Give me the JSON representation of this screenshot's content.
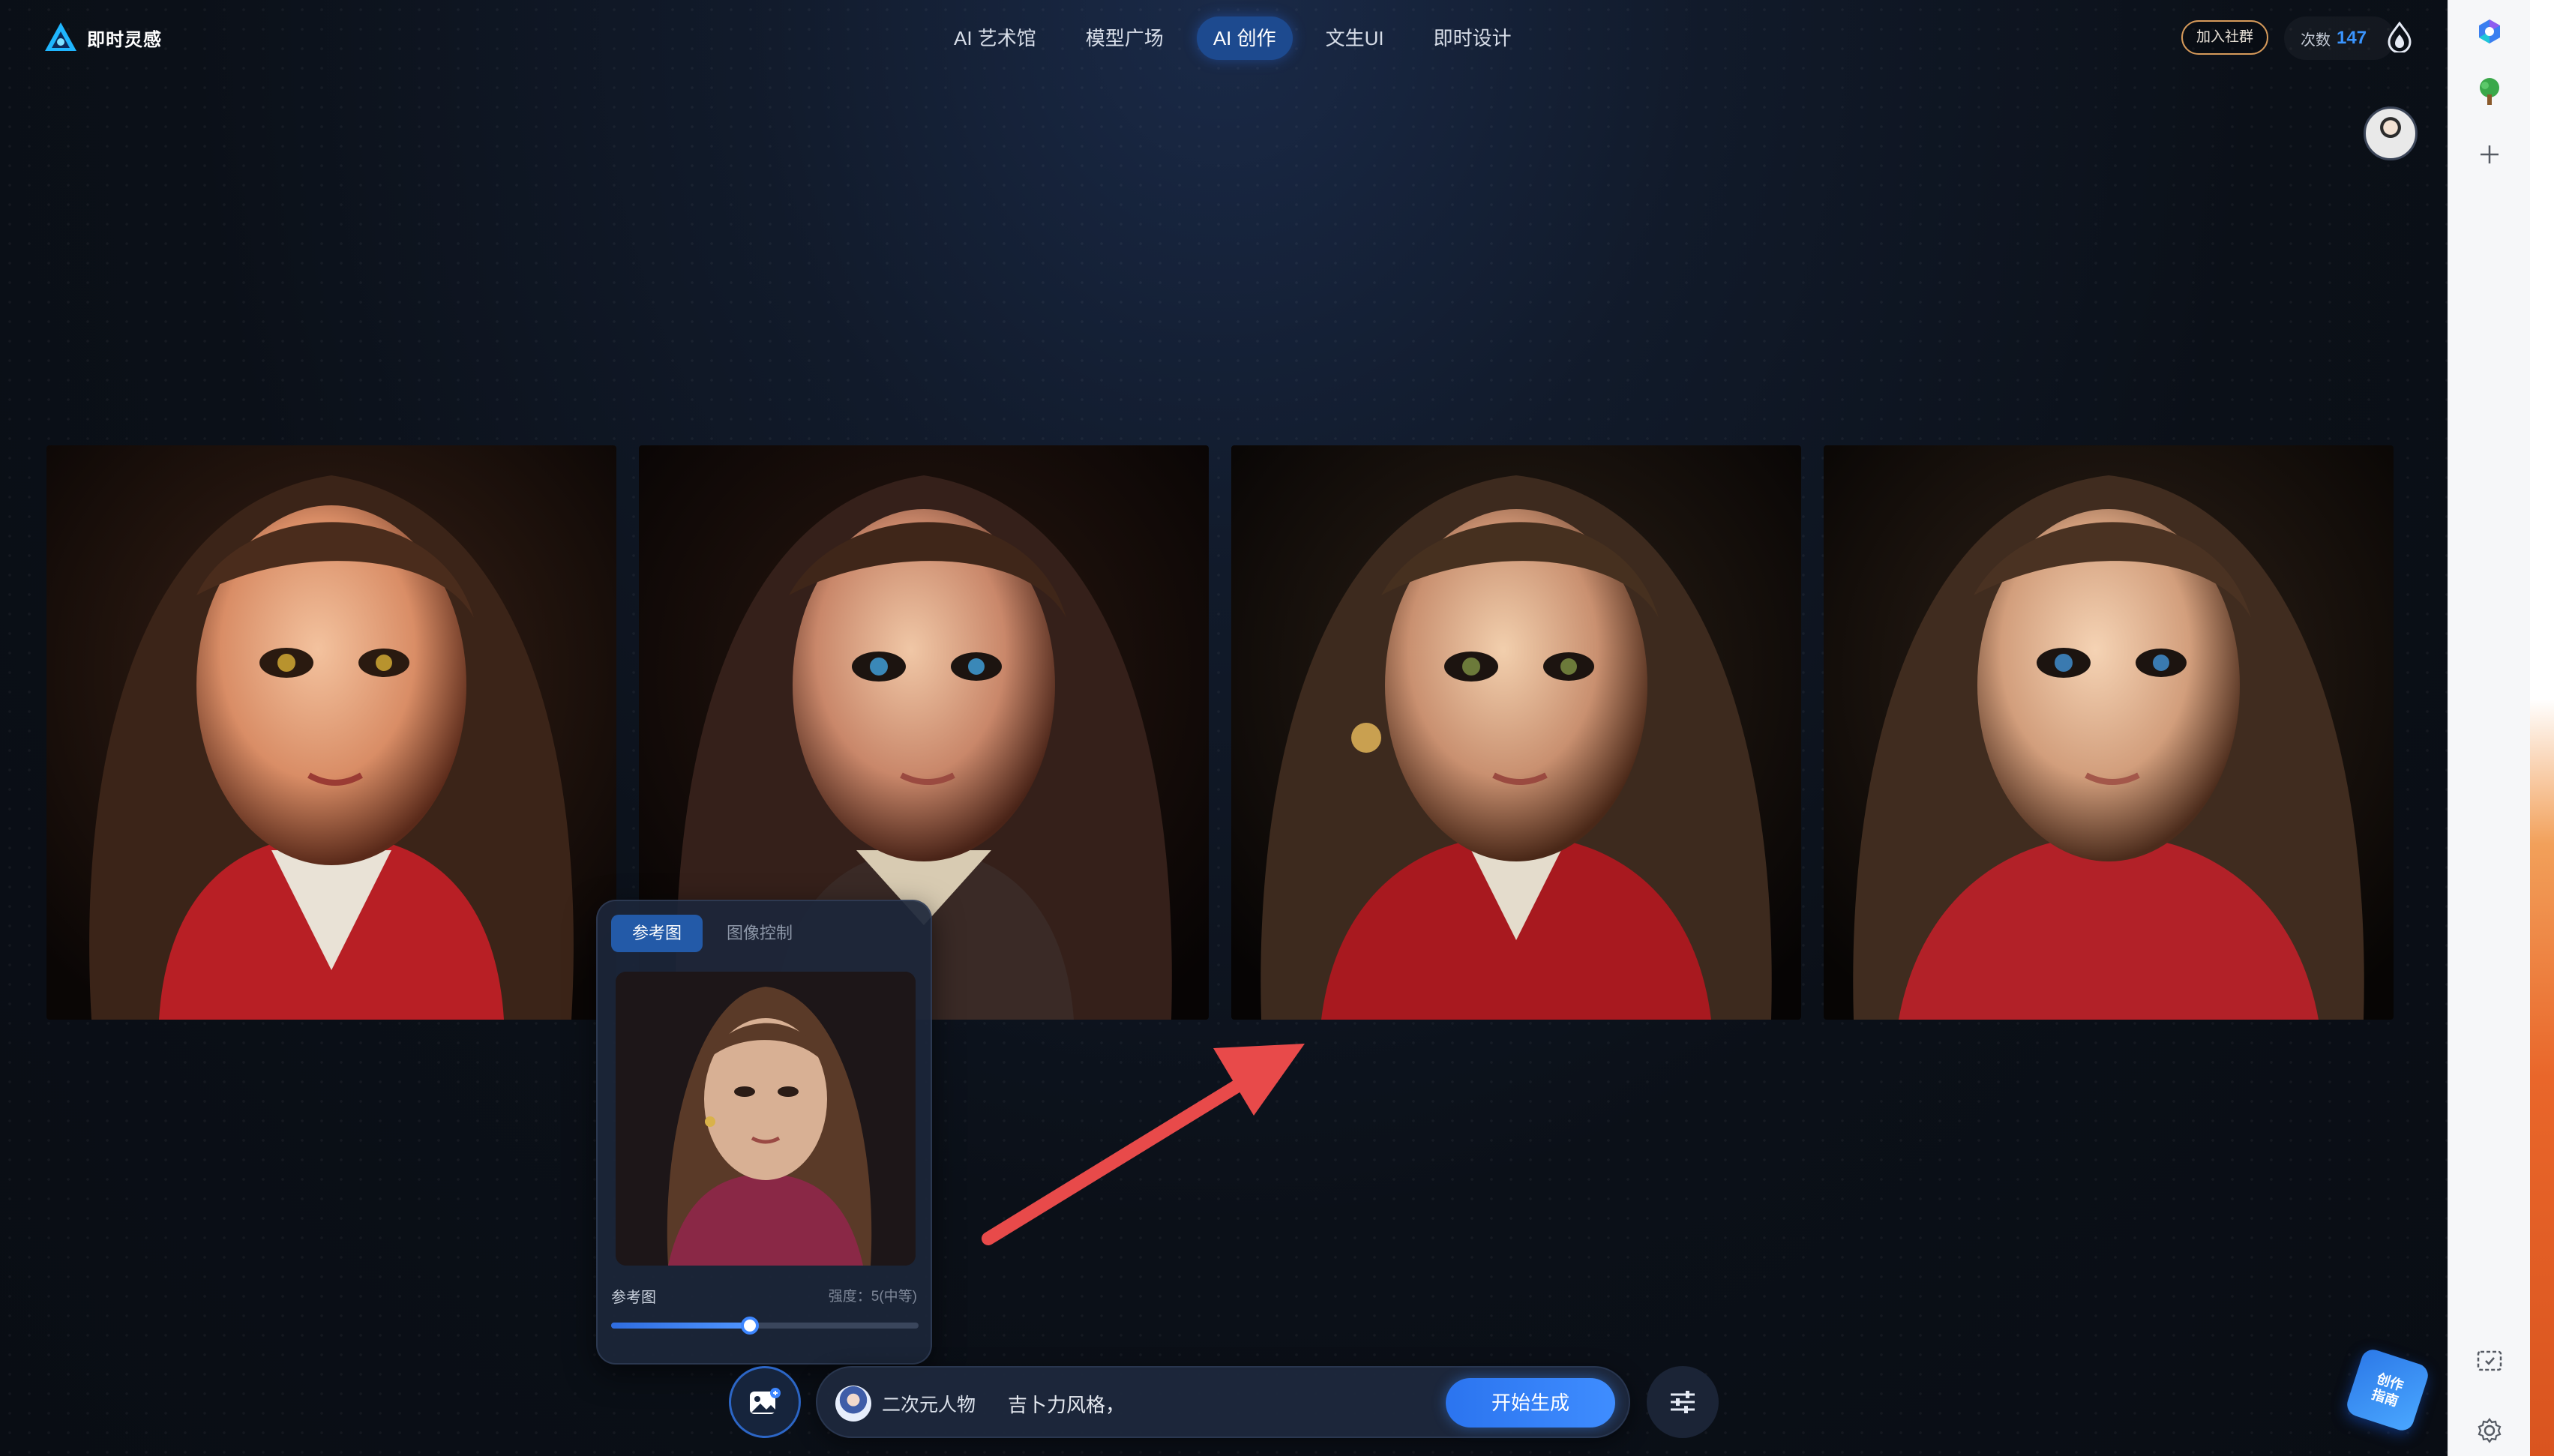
{
  "app": {
    "name": "即时灵感"
  },
  "nav": {
    "items": [
      {
        "label": "AI 艺术馆",
        "active": false
      },
      {
        "label": "模型广场",
        "active": false
      },
      {
        "label": "AI 创作",
        "active": true
      },
      {
        "label": "文生UI",
        "active": false
      },
      {
        "label": "即时设计",
        "active": false
      }
    ]
  },
  "header": {
    "join_label": "加入社群",
    "credits_label": "次数",
    "credits_value": "147"
  },
  "results": {
    "count": 4,
    "images": [
      {
        "description": "anime-style portrait, brown wavy hair, red top"
      },
      {
        "description": "anime-style portrait, blue eyes, ruffled collar"
      },
      {
        "description": "anime-style portrait, green-brown eyes, red jacket"
      },
      {
        "description": "anime-style portrait, blue eyes, red garment"
      }
    ]
  },
  "reference_panel": {
    "tabs": [
      {
        "label": "参考图",
        "active": true
      },
      {
        "label": "图像控制",
        "active": false
      }
    ],
    "label": "参考图",
    "strength_text": "强度：5(中等)",
    "strength_fraction": 0.45
  },
  "prompt_bar": {
    "model_name": "二次元人物",
    "prompt": "吉卜力风格，",
    "generate_label": "开始生成"
  },
  "guide_badge": {
    "line1": "创作",
    "line2": "指南"
  },
  "colors": {
    "accent": "#3a86ff",
    "nav_active": "#1d4a8f",
    "arrow": "#e84a4a",
    "join_border": "#d69a5a"
  },
  "icons": {
    "logo": "triangle-logo-icon",
    "credits": "flame-drop-icon",
    "upload": "image-upload-icon",
    "settings": "sliders-icon",
    "sidebar": [
      "copilot-icon",
      "tree-icon",
      "plus-icon",
      "screenshot-icon",
      "gear-icon"
    ]
  }
}
